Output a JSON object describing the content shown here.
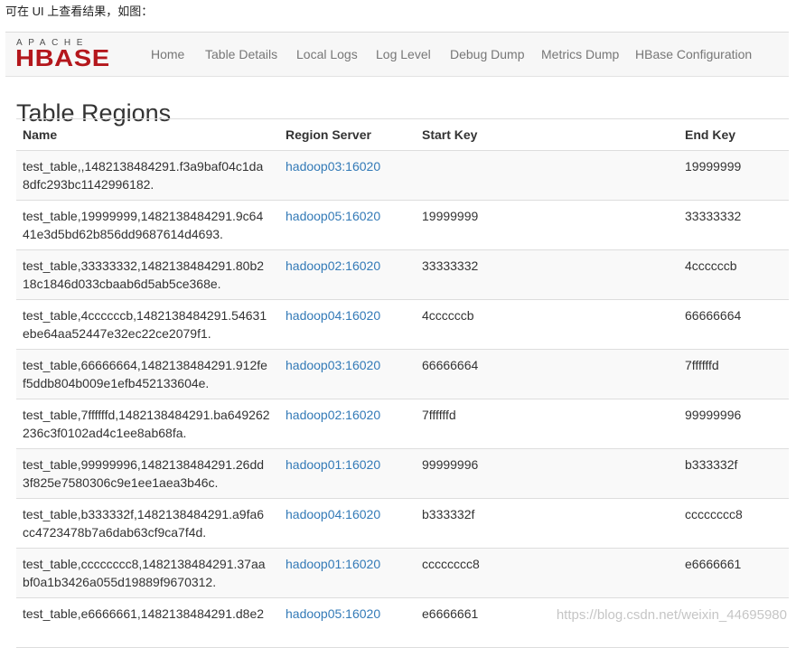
{
  "intro_text": "可在 UI 上查看结果，如图：",
  "logo": {
    "top_text": "APACHE",
    "main_text": "HBASE",
    "color": "#b4171c"
  },
  "nav": {
    "items": [
      "Home",
      "Table Details",
      "Local Logs",
      "Log Level",
      "Debug Dump",
      "Metrics Dump",
      "HBase Configuration"
    ]
  },
  "page_title": "Table Regions",
  "table": {
    "headers": [
      "Name",
      "Region Server",
      "Start Key",
      "End Key"
    ],
    "rows": [
      {
        "name": "test_table,,1482138484291.f3a9baf04c1da8dfc293bc1142996182.",
        "server": "hadoop03:16020",
        "start": "",
        "end": "19999999"
      },
      {
        "name": "test_table,19999999,1482138484291.9c6441e3d5bd62b856dd9687614d4693.",
        "server": "hadoop05:16020",
        "start": "19999999",
        "end": "33333332"
      },
      {
        "name": "test_table,33333332,1482138484291.80b218c1846d033cbaab6d5ab5ce368e.",
        "server": "hadoop02:16020",
        "start": "33333332",
        "end": "4ccccccb"
      },
      {
        "name": "test_table,4ccccccb,1482138484291.54631ebe64aa52447e32ec22ce2079f1.",
        "server": "hadoop04:16020",
        "start": "4ccccccb",
        "end": "66666664"
      },
      {
        "name": "test_table,66666664,1482138484291.912fef5ddb804b009e1efb452133604e.",
        "server": "hadoop03:16020",
        "start": "66666664",
        "end": "7ffffffd"
      },
      {
        "name": "test_table,7ffffffd,1482138484291.ba649262236c3f0102ad4c1ee8ab68fa.",
        "server": "hadoop02:16020",
        "start": "7ffffffd",
        "end": "99999996"
      },
      {
        "name": "test_table,99999996,1482138484291.26dd3f825e7580306c9e1ee1aea3b46c.",
        "server": "hadoop01:16020",
        "start": "99999996",
        "end": "b333332f"
      },
      {
        "name": "test_table,b333332f,1482138484291.a9fa6cc4723478b7a6dab63cf9ca7f4d.",
        "server": "hadoop04:16020",
        "start": "b333332f",
        "end": "cccccccc8"
      },
      {
        "name": "test_table,cccccccc8,1482138484291.37aabf0a1b3426a055d19889f9670312.",
        "server": "hadoop01:16020",
        "start": "cccccccc8",
        "end": "e6666661"
      },
      {
        "name": "test_table,e6666661,1482138484291.d8e2",
        "server": "hadoop05:16020",
        "start": "e6666661",
        "end": ""
      }
    ]
  },
  "watermark": "https://blog.csdn.net/weixin_44695980",
  "colors": {
    "link": "#337ab7",
    "nav_text": "#777777",
    "stripe": "#f9f9f9",
    "border": "#dddddd"
  }
}
